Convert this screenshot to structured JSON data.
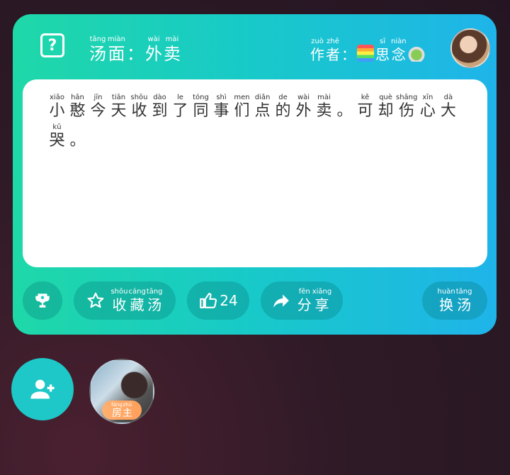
{
  "header": {
    "title": [
      {
        "py": "tāng",
        "hz": "汤"
      },
      {
        "py": "miàn",
        "hz": "面"
      },
      {
        "py": "",
        "hz": "："
      },
      {
        "py": "wài",
        "hz": "外"
      },
      {
        "py": "mài",
        "hz": "卖"
      }
    ],
    "author": [
      {
        "py": "zuò",
        "hz": "作"
      },
      {
        "py": "zhě",
        "hz": "者"
      },
      {
        "py": "",
        "hz": "："
      }
    ],
    "author_name": [
      {
        "py": "sī",
        "hz": "思"
      },
      {
        "py": "niàn",
        "hz": "念"
      }
    ],
    "author_emoji_left": "rainbow",
    "author_emoji_right": "matcha-tea"
  },
  "story": [
    {
      "py": "xiǎo",
      "hz": "小"
    },
    {
      "py": "hǎn",
      "hz": "憨"
    },
    {
      "py": "jīn",
      "hz": "今"
    },
    {
      "py": "tiān",
      "hz": "天"
    },
    {
      "py": "shōu",
      "hz": "收"
    },
    {
      "py": "dào",
      "hz": "到"
    },
    {
      "py": "le",
      "hz": "了"
    },
    {
      "py": "tóng",
      "hz": "同"
    },
    {
      "py": "shì",
      "hz": "事"
    },
    {
      "py": "men",
      "hz": "们"
    },
    {
      "py": "diǎn",
      "hz": "点"
    },
    {
      "py": "de",
      "hz": "的"
    },
    {
      "py": "wài",
      "hz": "外"
    },
    {
      "py": "mài",
      "hz": "卖"
    },
    {
      "py": "",
      "hz": "。"
    },
    {
      "py": "kě",
      "hz": "可"
    },
    {
      "py": "què",
      "hz": "却"
    },
    {
      "py": "shāng",
      "hz": "伤"
    },
    {
      "py": "xīn",
      "hz": "心"
    },
    {
      "py": "dà",
      "hz": "大"
    },
    {
      "py": "kū",
      "hz": "哭"
    },
    {
      "py": "",
      "hz": "。"
    }
  ],
  "actions": {
    "collect": [
      {
        "py": "shōu",
        "hz": "收"
      },
      {
        "py": "cáng",
        "hz": "藏"
      },
      {
        "py": "tāng",
        "hz": "汤"
      }
    ],
    "like_count": "24",
    "share": [
      {
        "py": "fēn",
        "hz": "分"
      },
      {
        "py": "xiǎng",
        "hz": "享"
      }
    ],
    "change": [
      {
        "py": "huàn",
        "hz": "换"
      },
      {
        "py": "tāng",
        "hz": "汤"
      }
    ]
  },
  "user_tag": [
    {
      "py": "fáng",
      "hz": "房"
    },
    {
      "py": "zhǔ",
      "hz": "主"
    }
  ],
  "colors": {
    "card_gradient_start": "#1fd8a8",
    "card_gradient_end": "#1fb4ea",
    "tag": "#ff9f5a"
  }
}
